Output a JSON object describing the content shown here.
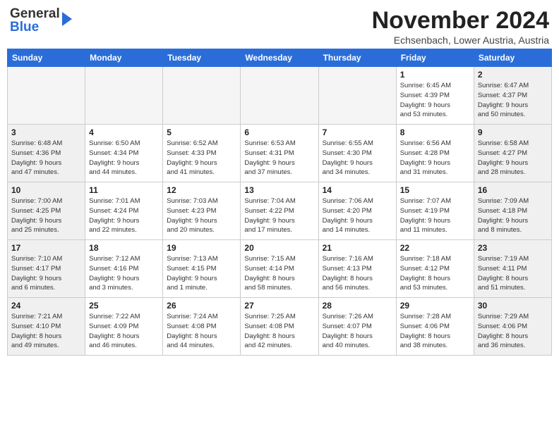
{
  "header": {
    "logo_general": "General",
    "logo_blue": "Blue",
    "month_title": "November 2024",
    "location": "Echsenbach, Lower Austria, Austria"
  },
  "calendar": {
    "headers": [
      "Sunday",
      "Monday",
      "Tuesday",
      "Wednesday",
      "Thursday",
      "Friday",
      "Saturday"
    ],
    "weeks": [
      [
        {
          "day": "",
          "info": "",
          "empty": true
        },
        {
          "day": "",
          "info": "",
          "empty": true
        },
        {
          "day": "",
          "info": "",
          "empty": true
        },
        {
          "day": "",
          "info": "",
          "empty": true
        },
        {
          "day": "",
          "info": "",
          "empty": true
        },
        {
          "day": "1",
          "info": "Sunrise: 6:45 AM\nSunset: 4:39 PM\nDaylight: 9 hours\nand 53 minutes."
        },
        {
          "day": "2",
          "info": "Sunrise: 6:47 AM\nSunset: 4:37 PM\nDaylight: 9 hours\nand 50 minutes.",
          "weekend": true
        }
      ],
      [
        {
          "day": "3",
          "info": "Sunrise: 6:48 AM\nSunset: 4:36 PM\nDaylight: 9 hours\nand 47 minutes.",
          "weekend": true
        },
        {
          "day": "4",
          "info": "Sunrise: 6:50 AM\nSunset: 4:34 PM\nDaylight: 9 hours\nand 44 minutes."
        },
        {
          "day": "5",
          "info": "Sunrise: 6:52 AM\nSunset: 4:33 PM\nDaylight: 9 hours\nand 41 minutes."
        },
        {
          "day": "6",
          "info": "Sunrise: 6:53 AM\nSunset: 4:31 PM\nDaylight: 9 hours\nand 37 minutes."
        },
        {
          "day": "7",
          "info": "Sunrise: 6:55 AM\nSunset: 4:30 PM\nDaylight: 9 hours\nand 34 minutes."
        },
        {
          "day": "8",
          "info": "Sunrise: 6:56 AM\nSunset: 4:28 PM\nDaylight: 9 hours\nand 31 minutes."
        },
        {
          "day": "9",
          "info": "Sunrise: 6:58 AM\nSunset: 4:27 PM\nDaylight: 9 hours\nand 28 minutes.",
          "weekend": true
        }
      ],
      [
        {
          "day": "10",
          "info": "Sunrise: 7:00 AM\nSunset: 4:25 PM\nDaylight: 9 hours\nand 25 minutes.",
          "weekend": true
        },
        {
          "day": "11",
          "info": "Sunrise: 7:01 AM\nSunset: 4:24 PM\nDaylight: 9 hours\nand 22 minutes."
        },
        {
          "day": "12",
          "info": "Sunrise: 7:03 AM\nSunset: 4:23 PM\nDaylight: 9 hours\nand 20 minutes."
        },
        {
          "day": "13",
          "info": "Sunrise: 7:04 AM\nSunset: 4:22 PM\nDaylight: 9 hours\nand 17 minutes."
        },
        {
          "day": "14",
          "info": "Sunrise: 7:06 AM\nSunset: 4:20 PM\nDaylight: 9 hours\nand 14 minutes."
        },
        {
          "day": "15",
          "info": "Sunrise: 7:07 AM\nSunset: 4:19 PM\nDaylight: 9 hours\nand 11 minutes."
        },
        {
          "day": "16",
          "info": "Sunrise: 7:09 AM\nSunset: 4:18 PM\nDaylight: 9 hours\nand 8 minutes.",
          "weekend": true
        }
      ],
      [
        {
          "day": "17",
          "info": "Sunrise: 7:10 AM\nSunset: 4:17 PM\nDaylight: 9 hours\nand 6 minutes.",
          "weekend": true
        },
        {
          "day": "18",
          "info": "Sunrise: 7:12 AM\nSunset: 4:16 PM\nDaylight: 9 hours\nand 3 minutes."
        },
        {
          "day": "19",
          "info": "Sunrise: 7:13 AM\nSunset: 4:15 PM\nDaylight: 9 hours\nand 1 minute."
        },
        {
          "day": "20",
          "info": "Sunrise: 7:15 AM\nSunset: 4:14 PM\nDaylight: 8 hours\nand 58 minutes."
        },
        {
          "day": "21",
          "info": "Sunrise: 7:16 AM\nSunset: 4:13 PM\nDaylight: 8 hours\nand 56 minutes."
        },
        {
          "day": "22",
          "info": "Sunrise: 7:18 AM\nSunset: 4:12 PM\nDaylight: 8 hours\nand 53 minutes."
        },
        {
          "day": "23",
          "info": "Sunrise: 7:19 AM\nSunset: 4:11 PM\nDaylight: 8 hours\nand 51 minutes.",
          "weekend": true
        }
      ],
      [
        {
          "day": "24",
          "info": "Sunrise: 7:21 AM\nSunset: 4:10 PM\nDaylight: 8 hours\nand 49 minutes.",
          "weekend": true
        },
        {
          "day": "25",
          "info": "Sunrise: 7:22 AM\nSunset: 4:09 PM\nDaylight: 8 hours\nand 46 minutes."
        },
        {
          "day": "26",
          "info": "Sunrise: 7:24 AM\nSunset: 4:08 PM\nDaylight: 8 hours\nand 44 minutes."
        },
        {
          "day": "27",
          "info": "Sunrise: 7:25 AM\nSunset: 4:08 PM\nDaylight: 8 hours\nand 42 minutes."
        },
        {
          "day": "28",
          "info": "Sunrise: 7:26 AM\nSunset: 4:07 PM\nDaylight: 8 hours\nand 40 minutes."
        },
        {
          "day": "29",
          "info": "Sunrise: 7:28 AM\nSunset: 4:06 PM\nDaylight: 8 hours\nand 38 minutes."
        },
        {
          "day": "30",
          "info": "Sunrise: 7:29 AM\nSunset: 4:06 PM\nDaylight: 8 hours\nand 36 minutes.",
          "weekend": true
        }
      ]
    ]
  }
}
